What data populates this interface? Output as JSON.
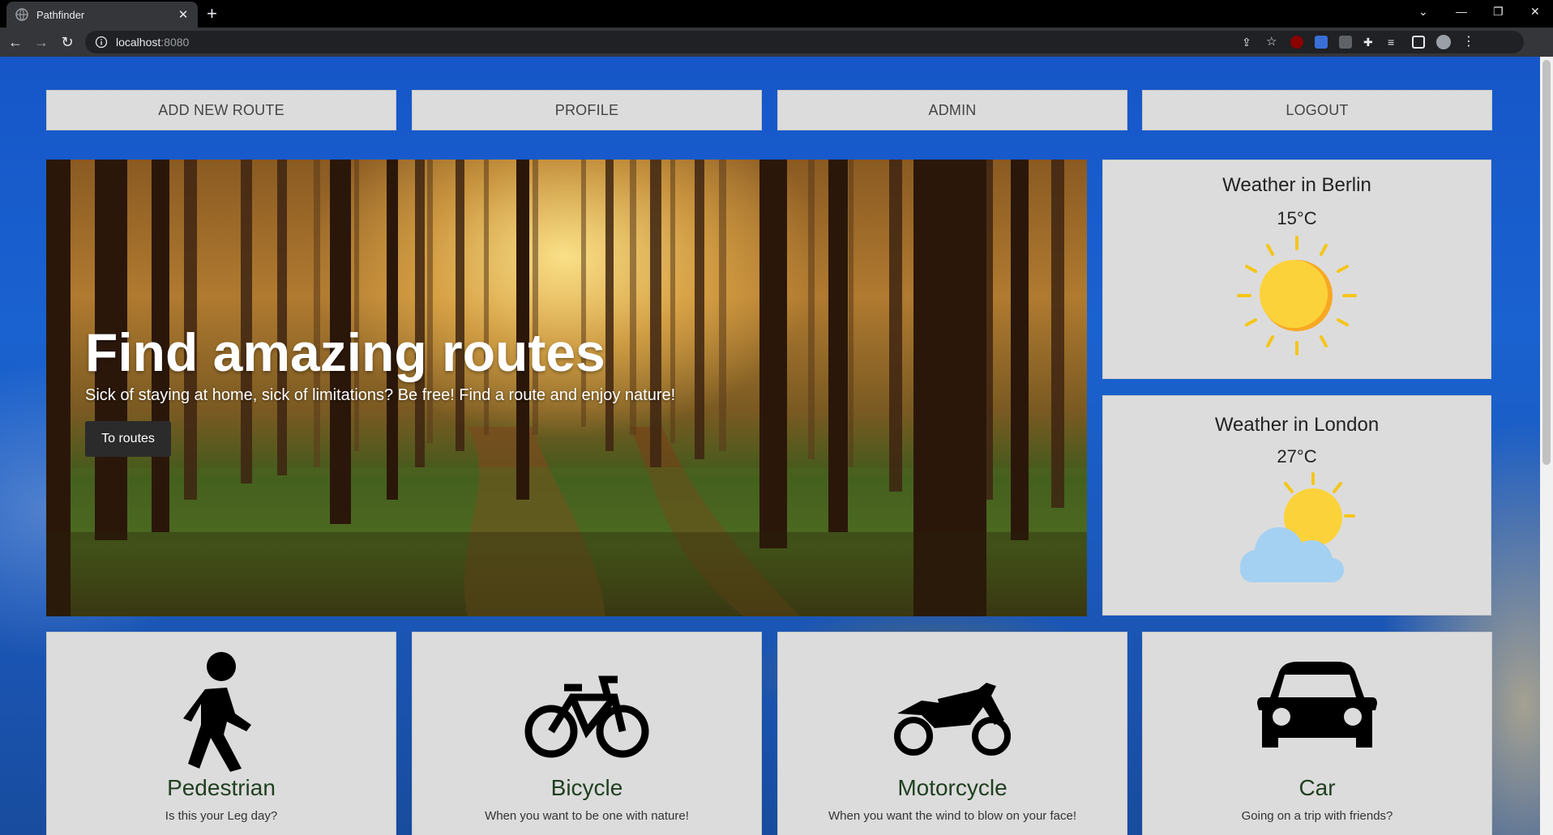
{
  "browser": {
    "tab_title": "Pathfinder",
    "url_host": "localhost",
    "url_port": ":8080"
  },
  "nav": {
    "add_route": "ADD NEW ROUTE",
    "profile": "PROFILE",
    "admin": "ADMIN",
    "logout": "LOGOUT"
  },
  "hero": {
    "title": "Find amazing routes",
    "subtitle": "Sick of staying at home, sick of limitations? Be free! Find a route and enjoy nature!",
    "button": "To routes"
  },
  "weather": [
    {
      "title": "Weather in Berlin",
      "temp": "15°C",
      "icon": "sun-icon"
    },
    {
      "title": "Weather in London",
      "temp": "27°C",
      "icon": "partly-cloudy-icon"
    }
  ],
  "categories": [
    {
      "title": "Pedestrian",
      "desc": "Is this your Leg day?",
      "icon": "pedestrian-icon"
    },
    {
      "title": "Bicycle",
      "desc": "When you want to be one with nature!",
      "icon": "bicycle-icon"
    },
    {
      "title": "Motorcycle",
      "desc": "When you want the wind to blow on your face!",
      "icon": "motorcycle-icon"
    },
    {
      "title": "Car",
      "desc": "Going on a trip with friends?",
      "icon": "car-icon"
    }
  ]
}
